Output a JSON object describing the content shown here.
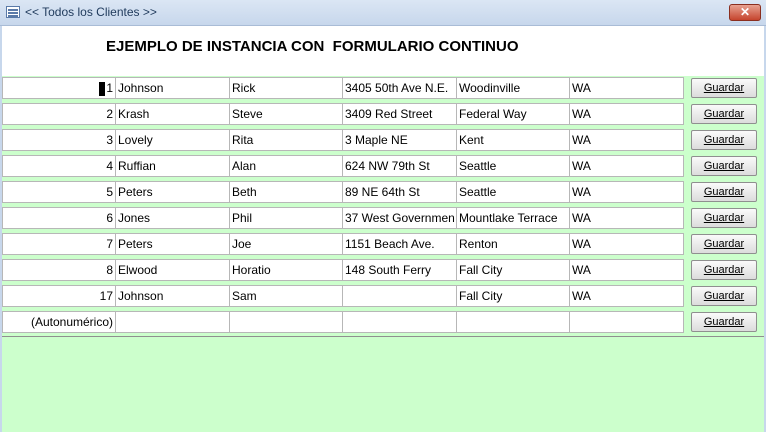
{
  "window": {
    "title": "<< Todos los Clientes >>",
    "close_glyph": "✕"
  },
  "header": {
    "title": "EJEMPLO DE INSTANCIA CON  FORMULARIO CONTINUO"
  },
  "records": [
    {
      "id": "1",
      "last": "Johnson",
      "first": "Rick",
      "address": "3405 50th Ave N.E.",
      "city": "Woodinville",
      "state": "WA",
      "button": "Guardar"
    },
    {
      "id": "2",
      "last": "Krash",
      "first": "Steve",
      "address": "3409 Red Street",
      "city": "Federal Way",
      "state": "WA",
      "button": "Guardar"
    },
    {
      "id": "3",
      "last": "Lovely",
      "first": "Rita",
      "address": "3 Maple NE",
      "city": "Kent",
      "state": "WA",
      "button": "Guardar"
    },
    {
      "id": "4",
      "last": "Ruffian",
      "first": "Alan",
      "address": "624 NW 79th St",
      "city": "Seattle",
      "state": "WA",
      "button": "Guardar"
    },
    {
      "id": "5",
      "last": "Peters",
      "first": "Beth",
      "address": "89 NE 64th St",
      "city": "Seattle",
      "state": "WA",
      "button": "Guardar"
    },
    {
      "id": "6",
      "last": "Jones",
      "first": "Phil",
      "address": "37 West Governmen",
      "city": "Mountlake Terrace",
      "state": "WA",
      "button": "Guardar"
    },
    {
      "id": "7",
      "last": "Peters",
      "first": "Joe",
      "address": "1151 Beach Ave.",
      "city": "Renton",
      "state": "WA",
      "button": "Guardar"
    },
    {
      "id": "8",
      "last": "Elwood",
      "first": "Horatio",
      "address": "148 South Ferry",
      "city": "Fall City",
      "state": "WA",
      "button": "Guardar"
    },
    {
      "id": "17",
      "last": "Johnson",
      "first": "Sam",
      "address": "",
      "city": "Fall City",
      "state": "WA",
      "button": "Guardar"
    },
    {
      "id": "(Autonumérico)",
      "last": "",
      "first": "",
      "address": "",
      "city": "",
      "state": "",
      "button": "Guardar"
    }
  ],
  "colors": {
    "form_background": "#ccffcc",
    "field_background": "#ffffff",
    "close_button": "#c5442d"
  }
}
